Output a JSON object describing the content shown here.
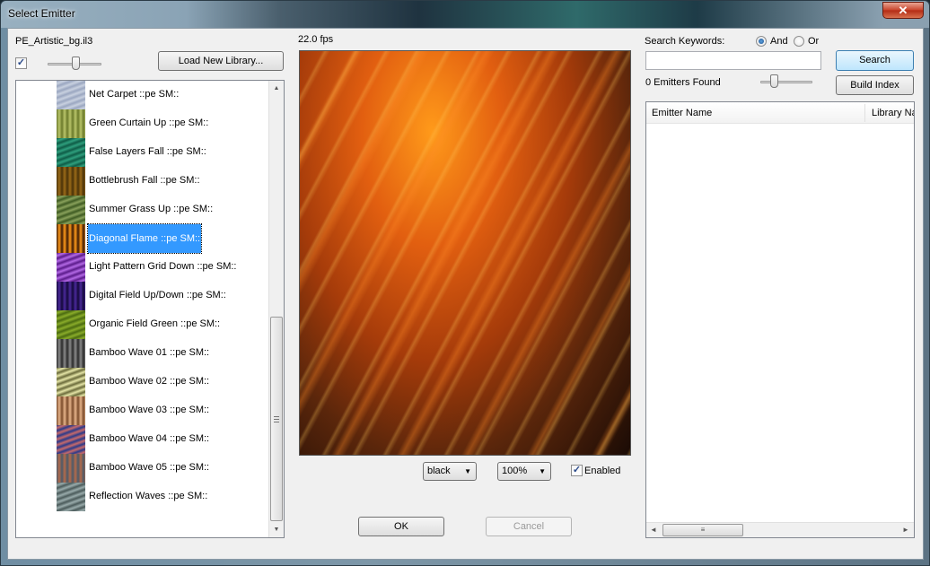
{
  "window": {
    "title": "Select Emitter",
    "close_glyph": "✕"
  },
  "library": {
    "name": "PE_Artistic_bg.il3",
    "checkbox_checked": true,
    "load_button": "Load New Library..."
  },
  "emitters": [
    {
      "label": "Net Carpet  ::pe SM::",
      "thumb": [
        "#9aa6c0",
        "#c9d1e0"
      ],
      "selected": false
    },
    {
      "label": "Green Curtain Up  ::pe SM::",
      "thumb": [
        "#6b7a2a",
        "#b9c46a"
      ],
      "selected": false
    },
    {
      "label": "False Layers Fall  ::pe SM::",
      "thumb": [
        "#0e5b46",
        "#2fa07e"
      ],
      "selected": false
    },
    {
      "label": "Bottlebrush Fall  ::pe SM::",
      "thumb": [
        "#4a3208",
        "#9a6a18"
      ],
      "selected": false
    },
    {
      "label": "Summer Grass Up  ::pe SM::",
      "thumb": [
        "#3e5a22",
        "#8aa25c"
      ],
      "selected": false
    },
    {
      "label": "Diagonal Flame  ::pe SM::",
      "thumb": [
        "#3a1804",
        "#ff9a1a"
      ],
      "selected": true
    },
    {
      "label": "Light Pattern Grid Down  ::pe SM::",
      "thumb": [
        "#5a1a8a",
        "#b46ae6"
      ],
      "selected": false
    },
    {
      "label": "Digital Field Up/Down  ::pe SM::",
      "thumb": [
        "#14083a",
        "#4a2a9a"
      ],
      "selected": false
    },
    {
      "label": "Organic Field Green  ::pe SM::",
      "thumb": [
        "#4a6a10",
        "#8aac2a"
      ],
      "selected": false
    },
    {
      "label": "Bamboo Wave 01  ::pe SM::",
      "thumb": [
        "#2a2a2a",
        "#8a8a8a"
      ],
      "selected": false
    },
    {
      "label": "Bamboo Wave 02  ::pe SM::",
      "thumb": [
        "#6a6a3a",
        "#e6e6a8"
      ],
      "selected": false
    },
    {
      "label": "Bamboo Wave 03  ::pe SM::",
      "thumb": [
        "#7a4a2a",
        "#e6b48a"
      ],
      "selected": false
    },
    {
      "label": "Bamboo Wave 04  ::pe SM::",
      "thumb": [
        "#2a3a8a",
        "#c86a6a"
      ],
      "selected": false
    },
    {
      "label": "Bamboo Wave 05  ::pe SM::",
      "thumb": [
        "#4a5a6a",
        "#b46a4a"
      ],
      "selected": false
    },
    {
      "label": "Reflection Waves  ::pe SM::",
      "thumb": [
        "#4a5a5a",
        "#9aacac"
      ],
      "selected": false
    }
  ],
  "preview": {
    "fps": "22.0 fps",
    "background_select": "black",
    "zoom_select": "100%",
    "enabled_label": "Enabled",
    "enabled_checked": true
  },
  "dialog_buttons": {
    "ok": "OK",
    "cancel": "Cancel"
  },
  "search": {
    "keywords_label": "Search Keywords:",
    "and_label": "And",
    "or_label": "Or",
    "mode": "And",
    "query": "",
    "search_button": "Search",
    "build_index_button": "Build Index",
    "found_text": "0 Emitters Found",
    "columns": [
      "Emitter Name",
      "Library Na"
    ]
  },
  "icons": {
    "check": "✓",
    "scroll_up": "▲",
    "scroll_down": "▼",
    "scroll_left": "◄",
    "scroll_right": "►",
    "dropdown": "▼",
    "grip": "≡"
  }
}
